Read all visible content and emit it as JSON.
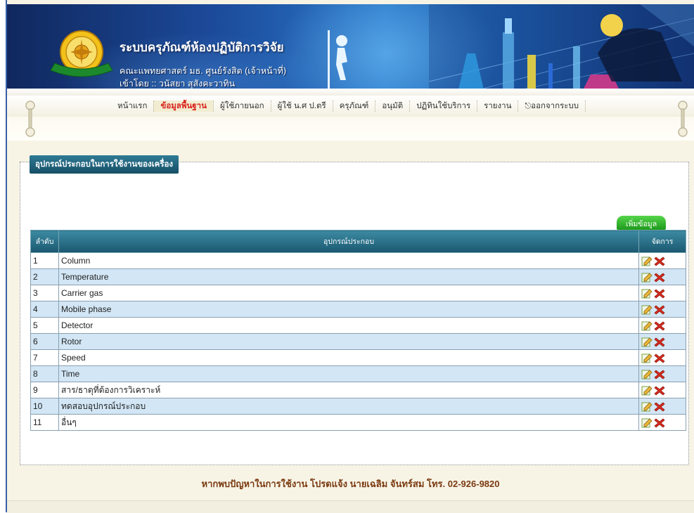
{
  "header": {
    "title": "ระบบครุภัณฑ์ห้องปฏิบัติการวิจัย",
    "faculty": "คณะแพทยศาสตร์ มธ. ศูนย์รังสิต (เจ้าหน้าที่)",
    "login_label": "เข้าโดย :: วนัสยา สุสังคะวาทิน",
    "seal_text": "คณะแพทยศาสตร์"
  },
  "nav": {
    "items": [
      {
        "label": "หน้าแรก",
        "active": false
      },
      {
        "label": "ข้อมูลพื้นฐาน",
        "active": true
      },
      {
        "label": "ผู้ใช้ภายนอก",
        "active": false
      },
      {
        "label": "ผู้ใช้ น.ศ ป.ตรี",
        "active": false
      },
      {
        "label": "ครุภัณฑ์",
        "active": false
      },
      {
        "label": "อนุมัติ",
        "active": false
      },
      {
        "label": "ปฏิทินใช้บริการ",
        "active": false
      },
      {
        "label": "รายงาน",
        "active": false
      },
      {
        "label": "ออกจากระบบ",
        "active": false
      }
    ]
  },
  "section": {
    "legend": "อุปกรณ์ประกอบในการใช้งานของเครื่อง",
    "add_button": "เพิ่มข้อมูล"
  },
  "table": {
    "headers": [
      "ลำดับ",
      "อุปกรณ์ประกอบ",
      "จัดการ"
    ],
    "rows": [
      {
        "no": "1",
        "name": "Column"
      },
      {
        "no": "2",
        "name": "Temperature"
      },
      {
        "no": "3",
        "name": "Carrier gas"
      },
      {
        "no": "4",
        "name": "Mobile phase"
      },
      {
        "no": "5",
        "name": "Detector"
      },
      {
        "no": "6",
        "name": "Rotor"
      },
      {
        "no": "7",
        "name": "Speed"
      },
      {
        "no": "8",
        "name": "Time"
      },
      {
        "no": "9",
        "name": "สาร/ธาตุที่ต้องการวิเคราะห์"
      },
      {
        "no": "10",
        "name": "ทดสอบอุปกรณ์ประกอบ"
      },
      {
        "no": "11",
        "name": "อื่นๆ"
      }
    ]
  },
  "footer": {
    "text": "หากพบปัญหาในการใช้งาน โปรดแจ้ง นายเฉลิม จันทร์สม โทร. 02-926-9820"
  },
  "colors": {
    "header_blue": "#1c4a9a",
    "nav_active": "#d8201a",
    "table_header": "#1a5870",
    "row_alt": "#d2e6f5",
    "add_button": "#1e9a1c",
    "footer_text": "#7a3a10"
  },
  "icons": {
    "edit": "edit-icon",
    "delete": "delete-icon"
  }
}
